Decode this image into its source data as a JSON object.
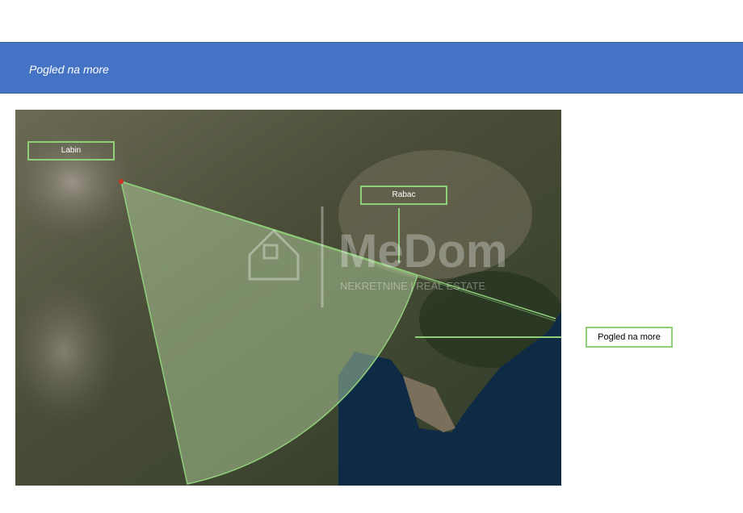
{
  "header": {
    "title": "Pogled na more"
  },
  "map": {
    "labels": {
      "labin": "Labin",
      "rabac": "Rabac"
    },
    "callout": "Pogled na more",
    "watermark": {
      "brand": "MeDom",
      "tagline": "NEKRETNINE | REAL ESTATE"
    },
    "colors": {
      "banner": "#4472c4",
      "highlight": "#8fcf7a",
      "sea": "#0f2a45"
    }
  }
}
